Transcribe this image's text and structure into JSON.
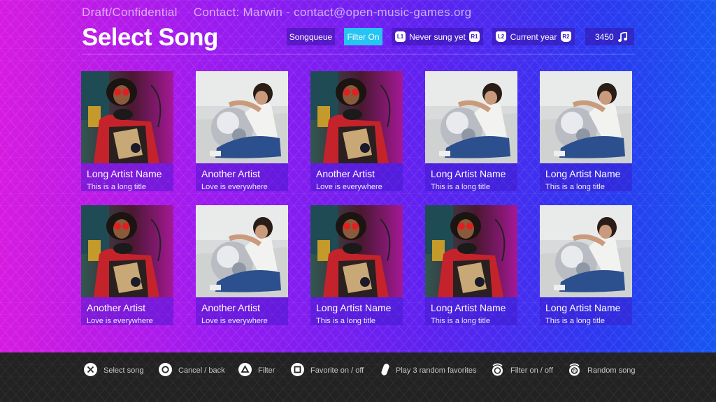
{
  "header": {
    "draft_label": "Draft/Confidential",
    "contact_label": "Contact: Marwin - contact@open-music-games.org",
    "title": "Select Song"
  },
  "toolbar": {
    "songqueue": "Songqueue",
    "filter": "Filter On",
    "l1_badge": "L1",
    "never_sung": "Never sung yet",
    "r1_badge": "R1",
    "l2_badge": "L2",
    "current_year": "Current year",
    "r2_badge": "R2",
    "song_count": "3450",
    "count_icon": "music-note-icon"
  },
  "songs": [
    {
      "artist": "Long Artist Name",
      "title": "This is a long title",
      "cover": "man-headphones"
    },
    {
      "artist": "Another Artist",
      "title": "Love is everywhere",
      "cover": "disco-ball"
    },
    {
      "artist": "Another Artist",
      "title": "Love is everywhere",
      "cover": "man-headphones"
    },
    {
      "artist": "Long Artist Name",
      "title": "This is a long title",
      "cover": "disco-ball"
    },
    {
      "artist": "Long Artist Name",
      "title": "This is a long title",
      "cover": "disco-ball"
    },
    {
      "artist": "Another Artist",
      "title": "Love is everywhere",
      "cover": "man-headphones"
    },
    {
      "artist": "Another Artist",
      "title": "Love is everywhere",
      "cover": "disco-ball"
    },
    {
      "artist": "Long Artist Name",
      "title": "This is a long title",
      "cover": "man-headphones"
    },
    {
      "artist": "Long Artist Name",
      "title": "This is a long title",
      "cover": "man-headphones"
    },
    {
      "artist": "Long Artist Name",
      "title": "This is a long title",
      "cover": "disco-ball"
    }
  ],
  "footer": [
    {
      "icon": "cross-button-icon",
      "label": "Select song"
    },
    {
      "icon": "circle-button-icon",
      "label": "Cancel / back"
    },
    {
      "icon": "triangle-button-icon",
      "label": "Filter"
    },
    {
      "icon": "square-button-icon",
      "label": "Favorite on / off"
    },
    {
      "icon": "pill-icon",
      "label": "Play 3 random favorites"
    },
    {
      "icon": "stick-left-icon",
      "label": "Filter on / off"
    },
    {
      "icon": "stick-right-icon",
      "label": "Random song"
    }
  ],
  "colors": {
    "accent_active": "#26c4f2",
    "footer_bg": "#222222",
    "card_meta_bg": "#3c19c8"
  }
}
